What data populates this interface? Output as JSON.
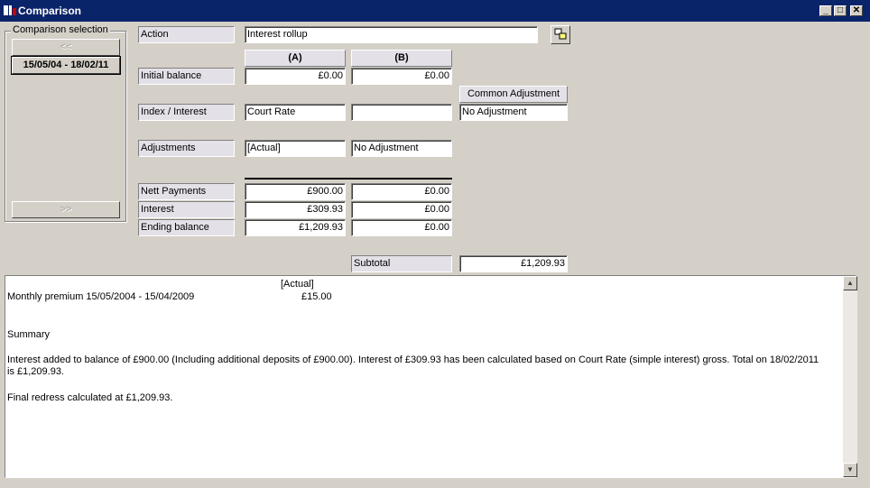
{
  "window": {
    "title": "Comparison"
  },
  "selection": {
    "group_label": "Comparison selection",
    "prev_label": "<<",
    "current_label": "15/05/04 - 18/02/11",
    "next_label": ">>"
  },
  "action": {
    "label": "Action",
    "value": "Interest rollup"
  },
  "columns": {
    "a": "(A)",
    "b": "(B)",
    "common": "Common Adjustment"
  },
  "rows": {
    "initial_balance": {
      "label": "Initial balance",
      "a": "£0.00",
      "b": "£0.00"
    },
    "index_interest": {
      "label": "Index / Interest",
      "a": "Court Rate",
      "b": "",
      "common": "No Adjustment"
    },
    "adjustments": {
      "label": "Adjustments",
      "a": "[Actual]",
      "b": "No Adjustment"
    },
    "nett_payments": {
      "label": "Nett Payments",
      "a": "£900.00",
      "b": "£0.00"
    },
    "interest": {
      "label": "Interest",
      "a": "£309.93",
      "b": "£0.00"
    },
    "ending_balance": {
      "label": "Ending balance",
      "a": "£1,209.93",
      "b": "£0.00"
    }
  },
  "subtotal": {
    "label": "Subtotal",
    "value": "£1,209.93"
  },
  "report": {
    "column_header": "[Actual]",
    "line_label": "Monthly premium 15/05/2004 - 15/04/2009",
    "line_value": "£15.00",
    "summary_heading": "Summary",
    "summary_text": "Interest added to balance of £900.00 (Including additional deposits of £900.00). Interest of £309.93 has been calculated based on Court Rate (simple interest) gross. Total on 18/02/2011 is £1,209.93.",
    "final_text": "Final redress calculated at £1,209.93."
  },
  "icons": {
    "window_icon": "window-app-icon",
    "swap": "swap-columns-icon"
  }
}
